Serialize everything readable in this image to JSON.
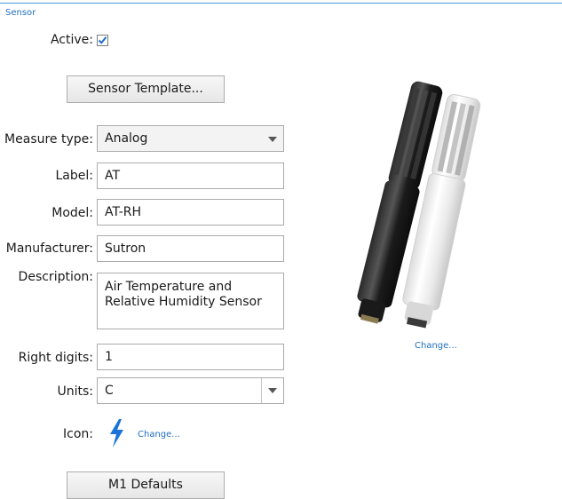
{
  "group": {
    "title": "Sensor"
  },
  "form": {
    "active_label": "Active:",
    "active_checked": true,
    "sensor_template_button": "Sensor Template...",
    "measure_type_label": "Measure type:",
    "measure_type_value": "Analog",
    "label_label": "Label:",
    "label_value": "AT",
    "model_label": "Model:",
    "model_value": "AT-RH",
    "manufacturer_label": "Manufacturer:",
    "manufacturer_value": "Sutron",
    "description_label": "Description:",
    "description_value": "Air Temperature and\nRelative Humidity Sensor",
    "right_digits_label": "Right digits:",
    "right_digits_value": "1",
    "units_label": "Units:",
    "units_value": "C",
    "icon_label": "Icon:",
    "icon_name": "lightning-bolt-icon",
    "icon_change_link": "Change...",
    "m1_defaults_button": "M1 Defaults"
  },
  "image": {
    "change_link": "Change...",
    "subject": "sensor-photo"
  },
  "colors": {
    "accent": "#1f6fc0",
    "group_line": "#4a9fd8",
    "icon_blue": "#1a73d9"
  }
}
